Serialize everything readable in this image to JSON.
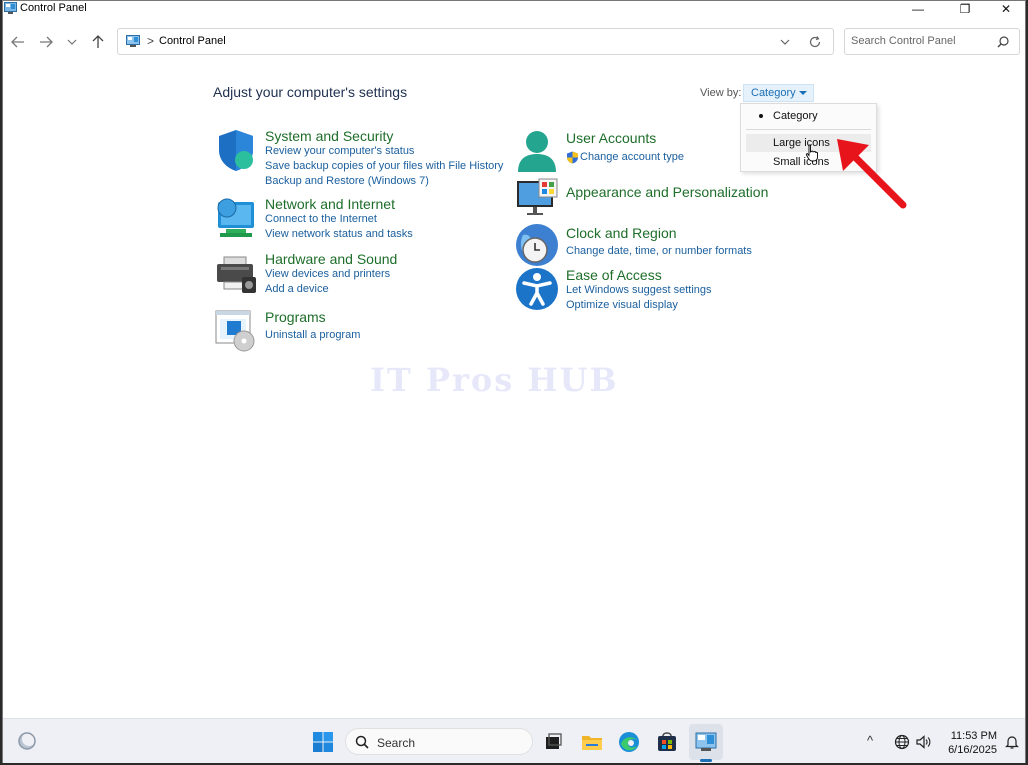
{
  "window": {
    "title": "Control Panel",
    "minimize": "—",
    "restore": "❐",
    "close": "✕"
  },
  "address": {
    "separator": ">",
    "crumb": "Control Panel"
  },
  "search": {
    "placeholder": "Search Control Panel"
  },
  "main": {
    "title": "Adjust your computer's settings",
    "view_by_label": "View by:",
    "view_by_value": "Category"
  },
  "view_menu": {
    "options": [
      "Category",
      "Large icons",
      "Small icons"
    ],
    "selected": "Category",
    "hovered": "Large icons"
  },
  "categories": [
    {
      "title": "System and Security",
      "links": [
        "Review your computer's status",
        "Save backup copies of your files with File History",
        "Backup and Restore (Windows 7)"
      ]
    },
    {
      "title": "Network and Internet",
      "links": [
        "Connect to the Internet",
        "View network status and tasks"
      ]
    },
    {
      "title": "Hardware and Sound",
      "links": [
        "View devices and printers",
        "Add a device"
      ]
    },
    {
      "title": "Programs",
      "links": [
        "Uninstall a program"
      ]
    },
    {
      "title": "User Accounts",
      "links": [
        "Change account type"
      ]
    },
    {
      "title": "Appearance and Personalization",
      "links": []
    },
    {
      "title": "Clock and Region",
      "links": [
        "Change date, time, or number formats"
      ]
    },
    {
      "title": "Ease of Access",
      "links": [
        "Let Windows suggest settings",
        "Optimize visual display"
      ]
    }
  ],
  "watermark": "IT Pros HUB",
  "taskbar": {
    "search_label": "Search",
    "time": "11:53 PM",
    "date": "6/16/2025",
    "tray_caret": "^"
  },
  "colors": {
    "category_title": "#1e6e2a",
    "link": "#1a5f9e",
    "accent": "#1a6fb5",
    "annotation_arrow": "#e8141c"
  }
}
